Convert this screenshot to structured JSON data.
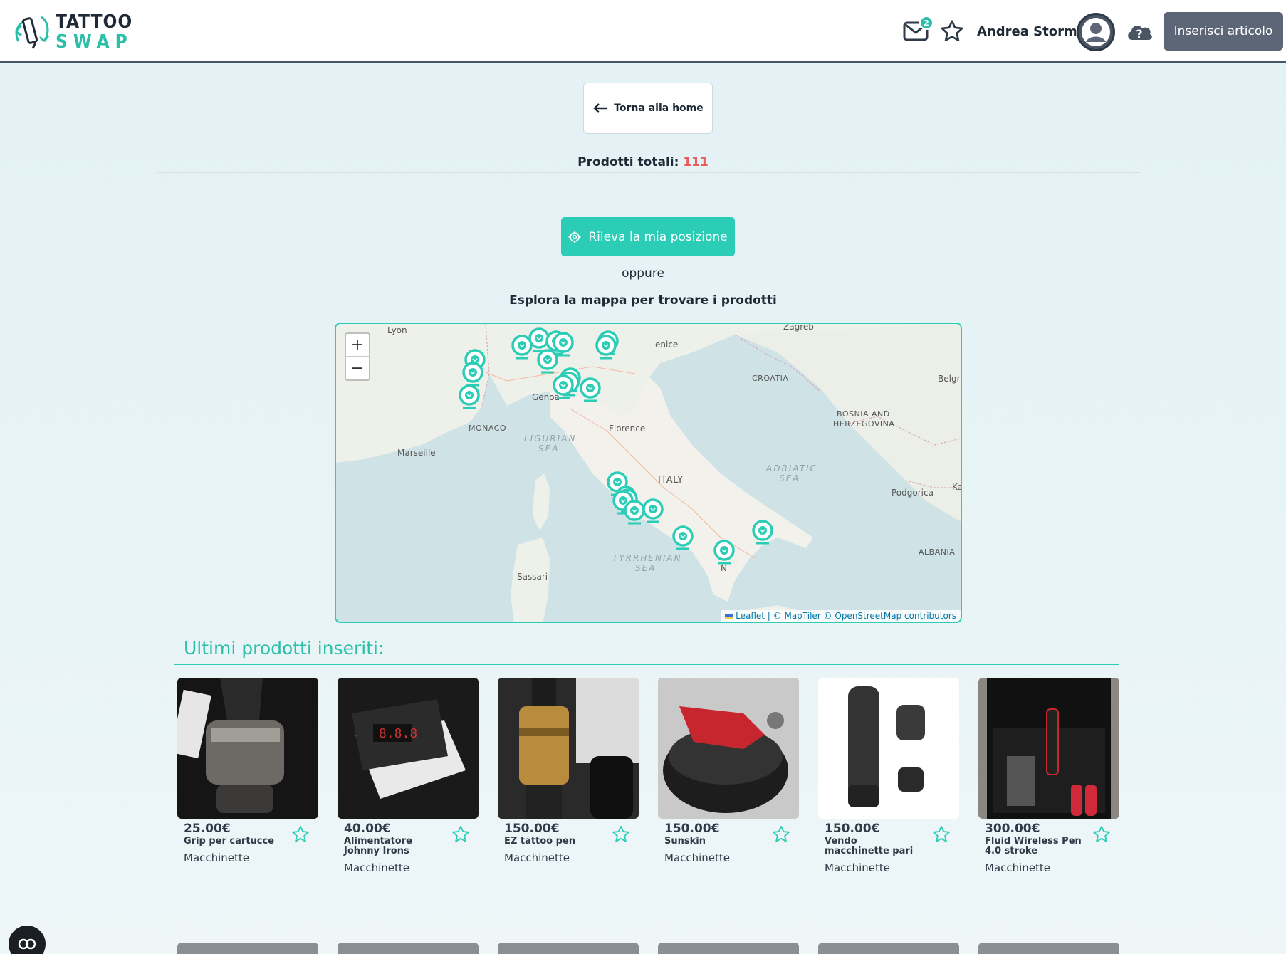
{
  "header": {
    "logo_line1": "TATTOO",
    "logo_line2": "SWAP",
    "mail_badge": "2",
    "user_name": "Andrea Storm",
    "insert_button": "Inserisci articolo"
  },
  "nav": {
    "back_label": "Torna alla home"
  },
  "totals": {
    "label": "Prodotti totali:",
    "count": "111"
  },
  "locate": {
    "button_label": "Rileva la mia posizione",
    "or_text": "oppure",
    "explore_text": "Esplora la mappa per trovare i prodotti"
  },
  "map": {
    "zoom_in": "+",
    "zoom_out": "−",
    "attribution_leaflet": "Leaflet",
    "attribution_rest": " | © MapTiler © OpenStreetMap contributors",
    "labels": {
      "lyon": "Lyon",
      "zagreb": "Zagreb",
      "venice": "enice",
      "genoa": "Genoa",
      "monaco": "MONACO",
      "florence": "Florence",
      "croatia": "CROATIA",
      "belgrade": "Belgr",
      "bosnia1": "BOSNIA AND",
      "bosnia2": "HERZEGOVINA",
      "marseille": "Marseille",
      "ligurian1": "LIGURIAN",
      "ligurian2": "SEA",
      "adriatic1": "ADRIATIC",
      "adriatic2": "SEA",
      "italy": "ITALY",
      "podgorica": "Podgorica",
      "ko": "Ko",
      "albania": "ALBANIA",
      "tyrrhenian1": "TYRRHENIAN",
      "tyrrhenian2": "SEA",
      "sassari": "Sassari",
      "naples": "N"
    }
  },
  "products_section": {
    "title": "Ultimi prodotti inseriti:",
    "items": [
      {
        "price": "25.00€",
        "title": "Grip per cartucce",
        "category": "Macchinette"
      },
      {
        "price": "40.00€",
        "title": "Alimentatore Johnny Irons",
        "category": "Macchinette"
      },
      {
        "price": "150.00€",
        "title": "EZ tattoo pen",
        "category": "Macchinette"
      },
      {
        "price": "150.00€",
        "title": "Sunskin",
        "category": "Macchinette"
      },
      {
        "price": "150.00€",
        "title": "Vendo macchinette pari",
        "category": "Macchinette"
      },
      {
        "price": "300.00€",
        "title": "Fluid Wireless Pen 4.0 stroke",
        "category": "Macchinette"
      }
    ]
  },
  "colors": {
    "accent": "#2bcdb6",
    "accent_dark": "#2bbfa9",
    "count_red": "#ea5b5b",
    "header_button": "#5d6677"
  },
  "icons": [
    "logo-icon",
    "mail-icon",
    "star-icon",
    "avatar-icon",
    "help-cloud-icon",
    "arrow-left-icon",
    "location-icon",
    "map-pin-icon",
    "chat-icon"
  ]
}
